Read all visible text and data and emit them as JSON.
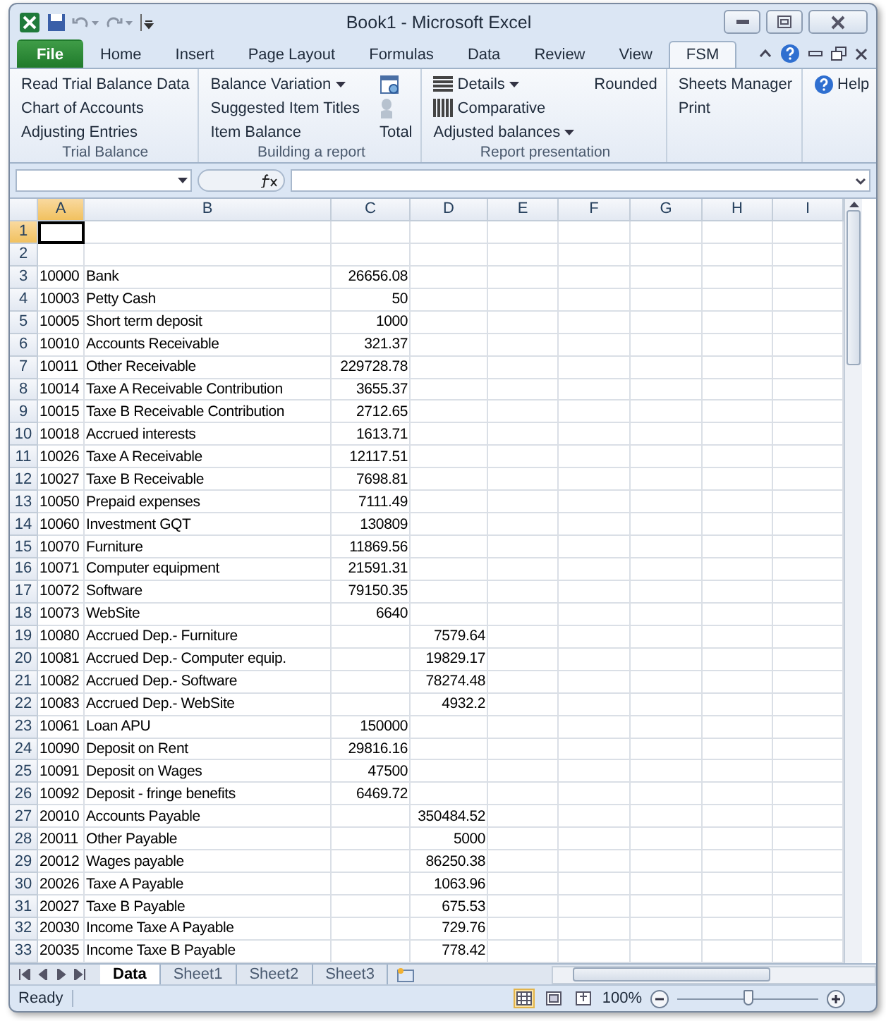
{
  "window": {
    "title": "Book1  -  Microsoft Excel"
  },
  "tabs": [
    {
      "label": "File",
      "selected": false,
      "kind": "file"
    },
    {
      "label": "Home",
      "selected": false,
      "kind": "tab"
    },
    {
      "label": "Insert",
      "selected": false,
      "kind": "tab"
    },
    {
      "label": "Page Layout",
      "selected": false,
      "kind": "tab"
    },
    {
      "label": "Formulas",
      "selected": false,
      "kind": "tab"
    },
    {
      "label": "Data",
      "selected": false,
      "kind": "tab"
    },
    {
      "label": "Review",
      "selected": false,
      "kind": "tab"
    },
    {
      "label": "View",
      "selected": false,
      "kind": "tab"
    },
    {
      "label": "FSM",
      "selected": true,
      "kind": "tab"
    }
  ],
  "ribbon": [
    {
      "label": "Trial Balance",
      "columns": [
        [
          {
            "label": "Read Trial Balance Data"
          },
          {
            "label": "Chart of Accounts"
          },
          {
            "label": "Adjusting Entries"
          }
        ]
      ]
    },
    {
      "label": "Building a report",
      "columns": [
        [
          {
            "label": "Balance Variation",
            "dropdown": true
          },
          {
            "label": "Suggested Item Titles"
          },
          {
            "label": "Item Balance"
          }
        ],
        [
          {
            "kind": "calendar"
          },
          {
            "kind": "figure"
          },
          {
            "label": "Total"
          }
        ]
      ]
    },
    {
      "label": "Report presentation",
      "columns": [
        [
          {
            "label": "Details",
            "kind": "lines",
            "dropdown": true
          },
          {
            "label": "Comparative",
            "kind": "bars"
          },
          {
            "label": "Adjusted balances",
            "dropdown": true
          }
        ],
        [
          {
            "label": "Rounded"
          }
        ]
      ]
    },
    {
      "columns": [
        [
          {
            "label": "Sheets Manager"
          },
          {
            "label": "Print"
          }
        ]
      ]
    },
    {
      "columns": [
        [
          {
            "label": "Help",
            "kind": "help"
          }
        ]
      ]
    }
  ],
  "columns": [
    {
      "label": "A",
      "selected": true
    },
    {
      "label": "B",
      "selected": false
    },
    {
      "label": "C",
      "selected": false
    },
    {
      "label": "D",
      "selected": false
    },
    {
      "label": "E",
      "selected": false
    },
    {
      "label": "F",
      "selected": false
    },
    {
      "label": "G",
      "selected": false
    },
    {
      "label": "H",
      "selected": false
    },
    {
      "label": "I",
      "selected": false
    }
  ],
  "rows": [
    {
      "number": "1",
      "selected": true
    },
    {
      "number": "2",
      "selected": false
    },
    {
      "number": "3",
      "selected": false,
      "a": "10000",
      "b": "Bank",
      "c": "26656.08"
    },
    {
      "number": "4",
      "selected": false,
      "a": "10003",
      "b": "Petty Cash",
      "c": "50"
    },
    {
      "number": "5",
      "selected": false,
      "a": "10005",
      "b": "Short term deposit",
      "c": "1000"
    },
    {
      "number": "6",
      "selected": false,
      "a": "10010",
      "b": "Accounts Receivable",
      "c": "321.37"
    },
    {
      "number": "7",
      "selected": false,
      "a": "10011",
      "b": "Other Receivable",
      "c": "229728.78"
    },
    {
      "number": "8",
      "selected": false,
      "a": "10014",
      "b": "Taxe A Receivable Contribution",
      "c": "3655.37"
    },
    {
      "number": "9",
      "selected": false,
      "a": "10015",
      "b": "Taxe B Receivable Contribution",
      "c": "2712.65"
    },
    {
      "number": "10",
      "selected": false,
      "a": "10018",
      "b": "Accrued interests",
      "c": "1613.71"
    },
    {
      "number": "11",
      "selected": false,
      "a": "10026",
      "b": "Taxe A Receivable",
      "c": "12117.51"
    },
    {
      "number": "12",
      "selected": false,
      "a": "10027",
      "b": "Taxe B Receivable",
      "c": "7698.81"
    },
    {
      "number": "13",
      "selected": false,
      "a": "10050",
      "b": "Prepaid expenses",
      "c": "7111.49"
    },
    {
      "number": "14",
      "selected": false,
      "a": "10060",
      "b": "Investment GQT",
      "c": "130809"
    },
    {
      "number": "15",
      "selected": false,
      "a": "10070",
      "b": "Furniture",
      "c": "11869.56"
    },
    {
      "number": "16",
      "selected": false,
      "a": "10071",
      "b": "Computer equipment",
      "c": "21591.31"
    },
    {
      "number": "17",
      "selected": false,
      "a": "10072",
      "b": "Software",
      "c": "79150.35"
    },
    {
      "number": "18",
      "selected": false,
      "a": "10073",
      "b": "WebSite",
      "c": "6640"
    },
    {
      "number": "19",
      "selected": false,
      "a": "10080",
      "b": "Accrued Dep.- Furniture",
      "d": "7579.64"
    },
    {
      "number": "20",
      "selected": false,
      "a": "10081",
      "b": "Accrued Dep.- Computer equip.",
      "d": "19829.17"
    },
    {
      "number": "21",
      "selected": false,
      "a": "10082",
      "b": "Accrued Dep.- Software",
      "d": "78274.48"
    },
    {
      "number": "22",
      "selected": false,
      "a": "10083",
      "b": "Accrued Dep.- WebSite",
      "d": "4932.2"
    },
    {
      "number": "23",
      "selected": false,
      "a": "10061",
      "b": "Loan APU",
      "c": "150000"
    },
    {
      "number": "24",
      "selected": false,
      "a": "10090",
      "b": "Deposit on Rent",
      "c": "29816.16"
    },
    {
      "number": "25",
      "selected": false,
      "a": "10091",
      "b": "Deposit on Wages",
      "c": "47500"
    },
    {
      "number": "26",
      "selected": false,
      "a": "10092",
      "b": "Deposit - fringe benefits",
      "c": "6469.72"
    },
    {
      "number": "27",
      "selected": false,
      "a": "20010",
      "b": "Accounts Payable",
      "d": "350484.52"
    },
    {
      "number": "28",
      "selected": false,
      "a": "20011",
      "b": "Other Payable",
      "d": "5000"
    },
    {
      "number": "29",
      "selected": false,
      "a": "20012",
      "b": "Wages payable",
      "d": "86250.38"
    },
    {
      "number": "30",
      "selected": false,
      "a": "20026",
      "b": "Taxe A Payable",
      "d": "1063.96"
    },
    {
      "number": "31",
      "selected": false,
      "a": "20027",
      "b": "Taxe B Payable",
      "d": "675.53"
    },
    {
      "number": "32",
      "selected": false,
      "a": "20030",
      "b": "Income Taxe A Payable",
      "d": "729.76"
    },
    {
      "number": "33",
      "selected": false,
      "a": "20035",
      "b": "Income Taxe B Payable",
      "d": "778.42"
    }
  ],
  "sheet_tabs": [
    {
      "label": "Data",
      "selected": true
    },
    {
      "label": "Sheet1",
      "selected": false
    },
    {
      "label": "Sheet2",
      "selected": false
    },
    {
      "label": "Sheet3",
      "selected": false
    }
  ],
  "status_bar": {
    "text": "Ready",
    "views": [
      {
        "selected": true,
        "kind": "normal"
      },
      {
        "selected": false,
        "kind": "layout"
      },
      {
        "selected": false,
        "kind": "break"
      }
    ],
    "zoom": "100%",
    "zoom_slider": {
      "level": 0.5
    }
  }
}
